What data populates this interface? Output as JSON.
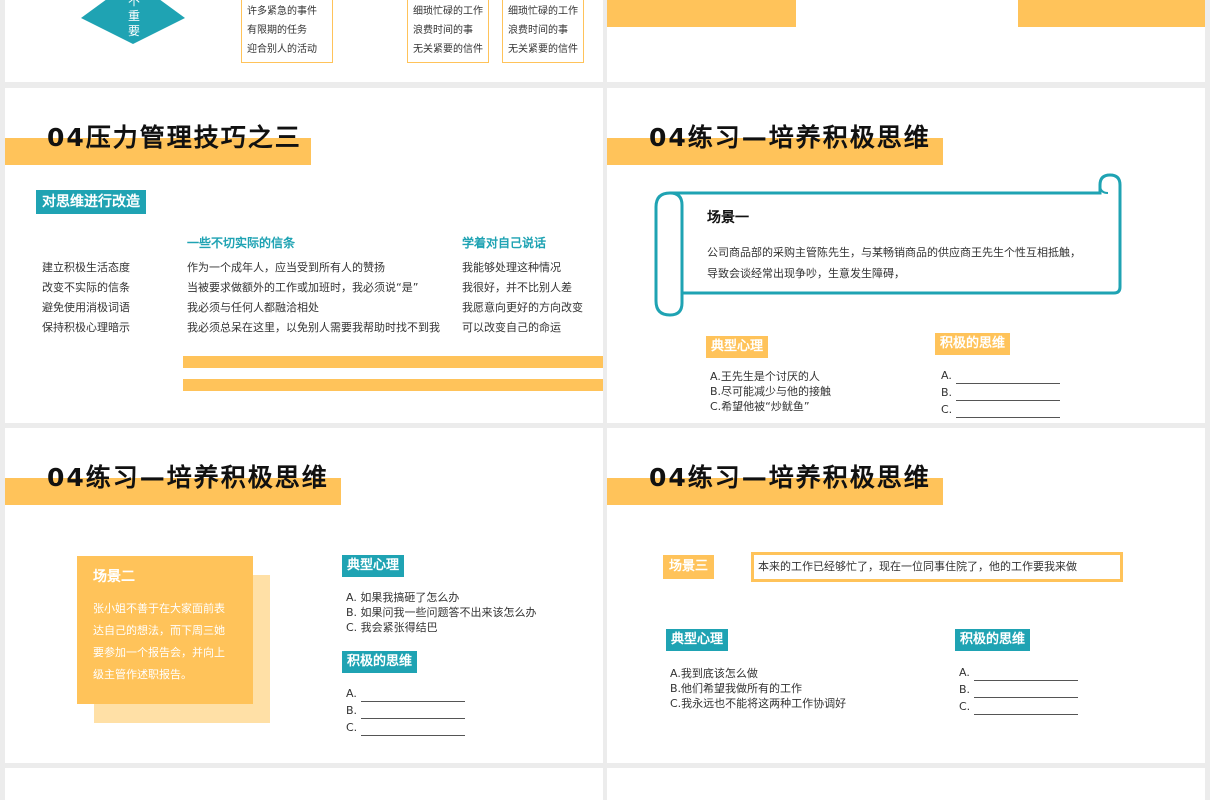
{
  "s1": {
    "diamond_label": "不\n重\n要",
    "box1": [
      "许多紧急的事件",
      "有限期的任务",
      "迎合别人的活动"
    ],
    "box2": [
      "细琐忙碌的工作",
      "浪费时间的事",
      "无关紧要的信件"
    ],
    "box3": [
      "细琐忙碌的工作",
      "浪费时间的事",
      "无关紧要的信件"
    ]
  },
  "s3": {
    "title": "04压力管理技巧之三",
    "tag": "对思维进行改造",
    "left_list": [
      "建立积极生活态度",
      "改变不实际的信条",
      "避免使用消极词语",
      "保持积极心理暗示"
    ],
    "mid_heading": "一些不切实际的信条",
    "mid_list": [
      "作为一个成年人，应当受到所有人的赞扬",
      "当被要求做额外的工作或加班时，我必须说“是”",
      "我必须与任何人都融洽相处",
      "我必须总呆在这里，以免别人需要我帮助时找不到我"
    ],
    "right_heading": "学着对自己说话",
    "right_list": [
      "我能够处理这种情况",
      "我很好，并不比别人差",
      "我愿意向更好的方向改变",
      "可以改变自己的命运"
    ]
  },
  "s4": {
    "title": "04练习—培养积极思维",
    "scene_title": "场景一",
    "scene_text": [
      "公司商品部的采购主管陈先生，与某畅销商品的供应商王先生个性互相抵触，",
      "导致会谈经常出现争吵，生意发生障碍，"
    ],
    "typical_label": "典型心理",
    "typical_items": [
      "A.王先生是个讨厌的人",
      "B.尽可能减少与他的接触",
      "C.希望他被“炒鱿鱼”"
    ],
    "positive_label": "积极的思维",
    "positive_items": [
      "A.",
      "B.",
      "C."
    ]
  },
  "s5": {
    "title": "04练习—培养积极思维",
    "scene_title": "场景二",
    "scene_text": [
      "张小姐不善于在大家面前表",
      "达自己的想法，而下周三她",
      "要参加一个报告会，并向上",
      "级主管作述职报告。"
    ],
    "typical_label": "典型心理",
    "typical_items": [
      "A. 如果我搞砸了怎么办",
      "B. 如果问我一些问题答不出来该怎么办",
      "C. 我会紧张得结巴"
    ],
    "positive_label": "积极的思维",
    "positive_items": [
      "A.",
      "B.",
      "C."
    ]
  },
  "s6": {
    "title": "04练习—培养积极思维",
    "scene_title": "场景三",
    "scene_text": "本来的工作已经够忙了，现在一位同事住院了，他的工作要我来做",
    "typical_label": "典型心理",
    "typical_items": [
      "A.我到底该怎么做",
      "B.他们希望我做所有的工作",
      "C.我永远也不能将这两种工作协调好"
    ],
    "positive_label": "积极的思维",
    "positive_items": [
      "A.",
      "B.",
      "C."
    ]
  },
  "colors": {
    "accent": "#ffc35a",
    "teal": "#1fa3b3",
    "background": "#ececec"
  }
}
